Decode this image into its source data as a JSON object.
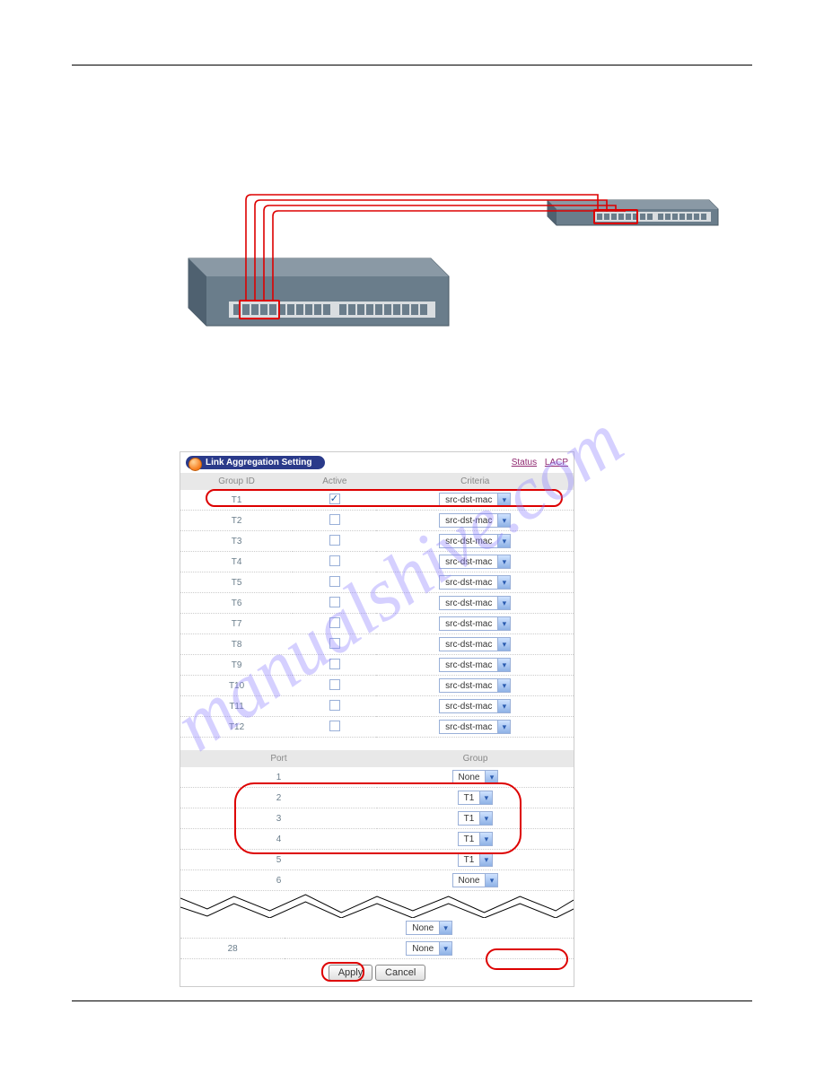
{
  "watermark": "manualshive.com",
  "panel": {
    "title": "Link Aggregation Setting",
    "links": {
      "status": "Status",
      "lacp": "LACP"
    },
    "groups": {
      "headers": [
        "Group ID",
        "Active",
        "Criteria"
      ],
      "rows": [
        {
          "id": "T1",
          "active": true,
          "criteria": "src-dst-mac"
        },
        {
          "id": "T2",
          "active": false,
          "criteria": "src-dst-mac"
        },
        {
          "id": "T3",
          "active": false,
          "criteria": "src-dst-mac"
        },
        {
          "id": "T4",
          "active": false,
          "criteria": "src-dst-mac"
        },
        {
          "id": "T5",
          "active": false,
          "criteria": "src-dst-mac"
        },
        {
          "id": "T6",
          "active": false,
          "criteria": "src-dst-mac"
        },
        {
          "id": "T7",
          "active": false,
          "criteria": "src-dst-mac"
        },
        {
          "id": "T8",
          "active": false,
          "criteria": "src-dst-mac"
        },
        {
          "id": "T9",
          "active": false,
          "criteria": "src-dst-mac"
        },
        {
          "id": "T10",
          "active": false,
          "criteria": "src-dst-mac"
        },
        {
          "id": "T11",
          "active": false,
          "criteria": "src-dst-mac"
        },
        {
          "id": "T12",
          "active": false,
          "criteria": "src-dst-mac"
        }
      ]
    },
    "ports": {
      "headers": [
        "Port",
        "Group"
      ],
      "rows_top": [
        {
          "port": "1",
          "group": "None"
        },
        {
          "port": "2",
          "group": "T1"
        },
        {
          "port": "3",
          "group": "T1"
        },
        {
          "port": "4",
          "group": "T1"
        },
        {
          "port": "5",
          "group": "T1"
        },
        {
          "port": "6",
          "group": "None"
        }
      ],
      "rows_bottom": [
        {
          "port": "",
          "group": "None"
        },
        {
          "port": "28",
          "group": "None"
        }
      ]
    },
    "buttons": {
      "apply": "Apply",
      "cancel": "Cancel"
    }
  }
}
